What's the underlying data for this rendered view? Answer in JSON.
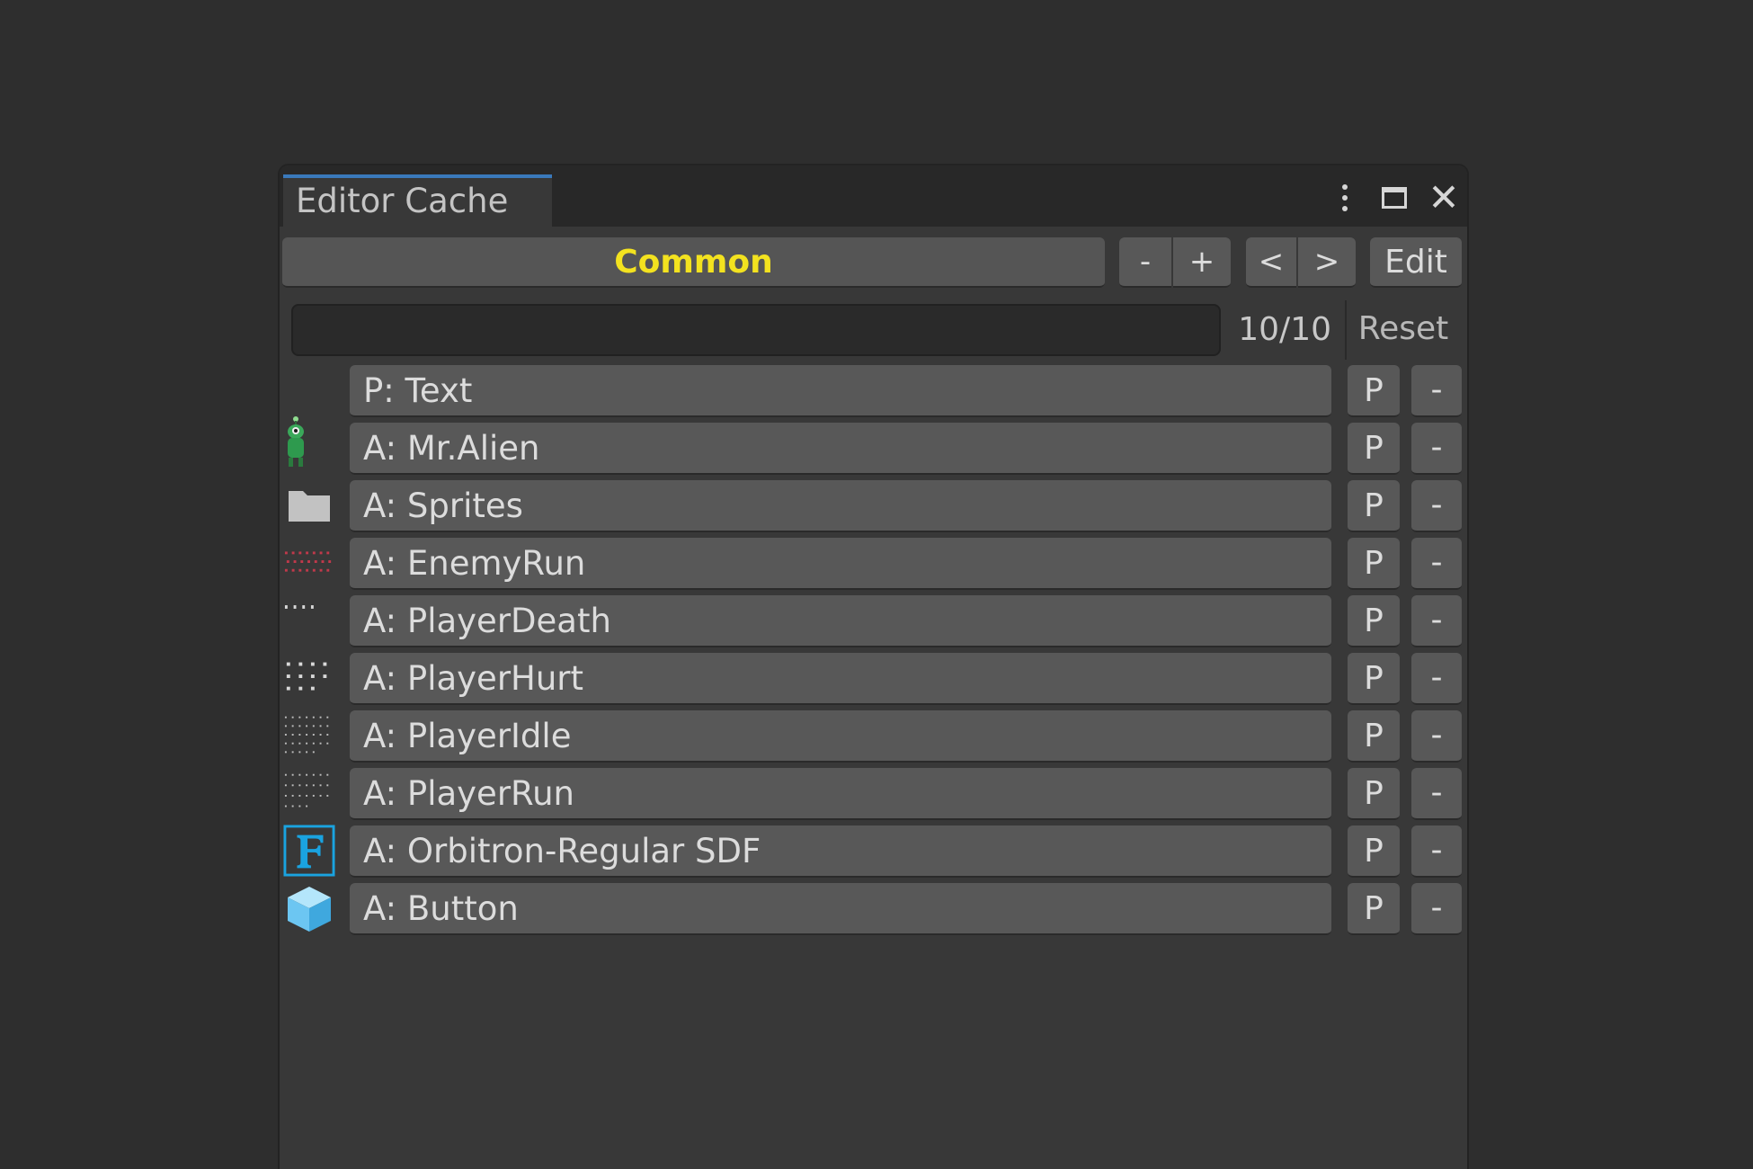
{
  "window": {
    "tab_title": "Editor Cache"
  },
  "toolbar": {
    "group_name": "Common",
    "group_name_color": "#f3e21f",
    "minus_label": "-",
    "plus_label": "+",
    "prev_label": "<",
    "next_label": ">",
    "edit_label": "Edit"
  },
  "filter": {
    "search_value": "",
    "count": "10/10",
    "reset_label": "Reset"
  },
  "items": [
    {
      "label": "P: Text",
      "icon": "none",
      "ping_label": "P",
      "remove_label": "-"
    },
    {
      "label": "A: Mr.Alien",
      "icon": "alien-sprite-icon",
      "ping_label": "P",
      "remove_label": "-"
    },
    {
      "label": "A: Sprites",
      "icon": "folder-icon",
      "ping_label": "P",
      "remove_label": "-"
    },
    {
      "label": "A: EnemyRun",
      "icon": "enemy-spritesheet-icon",
      "ping_label": "P",
      "remove_label": "-"
    },
    {
      "label": "A: PlayerDeath",
      "icon": "player-death-spritesheet-icon",
      "ping_label": "P",
      "remove_label": "-"
    },
    {
      "label": "A: PlayerHurt",
      "icon": "player-hurt-spritesheet-icon",
      "ping_label": "P",
      "remove_label": "-"
    },
    {
      "label": "A: PlayerIdle",
      "icon": "player-idle-spritesheet-icon",
      "ping_label": "P",
      "remove_label": "-"
    },
    {
      "label": "A: PlayerRun",
      "icon": "player-run-spritesheet-icon",
      "ping_label": "P",
      "remove_label": "-"
    },
    {
      "label": "A: Orbitron-Regular SDF",
      "icon": "font-asset-icon",
      "ping_label": "P",
      "remove_label": "-"
    },
    {
      "label": "A: Button",
      "icon": "prefab-cube-icon",
      "ping_label": "P",
      "remove_label": "-"
    }
  ],
  "colors": {
    "accent_tab": "#3a79bb",
    "font_icon": "#1aa3e0",
    "prefab_icon": "#6cc6f2",
    "enemy_dots": "#c0394b"
  }
}
